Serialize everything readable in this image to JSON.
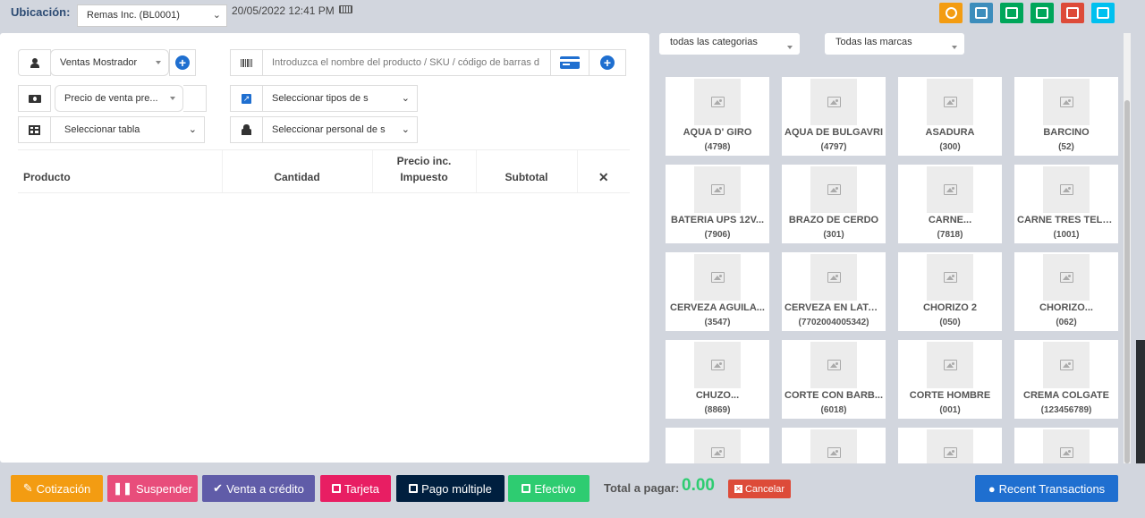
{
  "header": {
    "location_label": "Ubicación:",
    "location_value": "Remas Inc. (BL0001)",
    "datetime": "20/05/2022 12:41 PM",
    "toolbar_icons": [
      "pause-icon",
      "window-icon",
      "calculator-icon",
      "briefcase-icon",
      "close-icon",
      "rewind-icon"
    ]
  },
  "form": {
    "customer": "Ventas Mostrador",
    "search_placeholder": "Introduzca el nombre del producto / SKU / código de barras d",
    "price_group": "Precio de venta pre...",
    "service_type": "Seleccionar tipos de s",
    "table": "Seleccionar tabla",
    "staff": "Seleccionar personal de s"
  },
  "table": {
    "col_product": "Producto",
    "col_qty": "Cantidad",
    "col_price_line1": "Precio inc.",
    "col_price_line2": "Impuesto",
    "col_subtotal": "Subtotal",
    "col_remove": "✕"
  },
  "filters": {
    "category": "todas las categorias",
    "brand": "Todas las marcas"
  },
  "products": [
    {
      "name": "AQUA D' GIRO",
      "sku": "(4798)"
    },
    {
      "name": "AQUA DE BULGAVRI",
      "sku": "(4797)"
    },
    {
      "name": "ASADURA",
      "sku": "(300)"
    },
    {
      "name": "BARCINO",
      "sku": "(52)"
    },
    {
      "name": "BATERIA UPS 12V...",
      "sku": "(7906)"
    },
    {
      "name": "BRAZO DE CERDO",
      "sku": "(301)"
    },
    {
      "name": "CARNE...",
      "sku": "(7818)"
    },
    {
      "name": "CARNE TRES TELA...",
      "sku": "(1001)"
    },
    {
      "name": "CERVEZA AGUILA...",
      "sku": "(3547)"
    },
    {
      "name": "CERVEZA EN LATA...",
      "sku": "(7702004005342)"
    },
    {
      "name": "CHORIZO 2",
      "sku": "(050)"
    },
    {
      "name": "CHORIZO...",
      "sku": "(062)"
    },
    {
      "name": "CHUZO...",
      "sku": "(8869)"
    },
    {
      "name": "CORTE CON BARB...",
      "sku": "(6018)"
    },
    {
      "name": "CORTE HOMBRE",
      "sku": "(001)"
    },
    {
      "name": "CREMA COLGATE",
      "sku": "(123456789)"
    },
    {
      "name": "",
      "sku": ""
    },
    {
      "name": "",
      "sku": ""
    },
    {
      "name": "",
      "sku": ""
    },
    {
      "name": "",
      "sku": ""
    }
  ],
  "footer": {
    "quotation": "Cotización",
    "suspend": "Suspender",
    "credit_sale": "Venta a crédito",
    "card": "Tarjeta",
    "multiple_pay": "Pago múltiple",
    "cash": "Efectivo",
    "total_label": "Total a pagar:",
    "total_value": "0.00",
    "cancel": "Cancelar",
    "recent": "Recent Transactions"
  },
  "colors": {
    "accent": "#1f6fd0",
    "total": "#2ecc71",
    "background": "#d2d6de"
  }
}
